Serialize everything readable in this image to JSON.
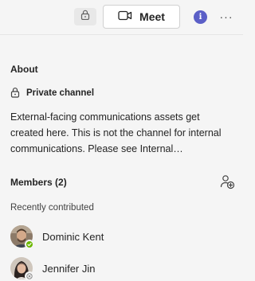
{
  "header": {
    "meet_label": "Meet",
    "info_label": "i",
    "more_label": "···"
  },
  "about": {
    "title": "About",
    "channel_type": "Private channel",
    "description": "External-facing communications assets get created here. This is not the channel for internal communications. Please see Internal Communications channel."
  },
  "members": {
    "title": "Members (2)",
    "recent_label": "Recently contributed",
    "list": [
      {
        "name": "Dominic Kent",
        "presence": "available",
        "presence_color": "#6bb700"
      },
      {
        "name": "Jennifer Jin",
        "presence": "offline",
        "presence_color": "#8a8a8a"
      }
    ]
  },
  "colors": {
    "accent": "#5b5fc7",
    "background": "#f5f5f5"
  },
  "icons": {
    "lock": "lock-icon",
    "video": "video-camera-icon",
    "info": "info-icon",
    "more": "more-options-icon",
    "add_member": "add-member-icon"
  }
}
